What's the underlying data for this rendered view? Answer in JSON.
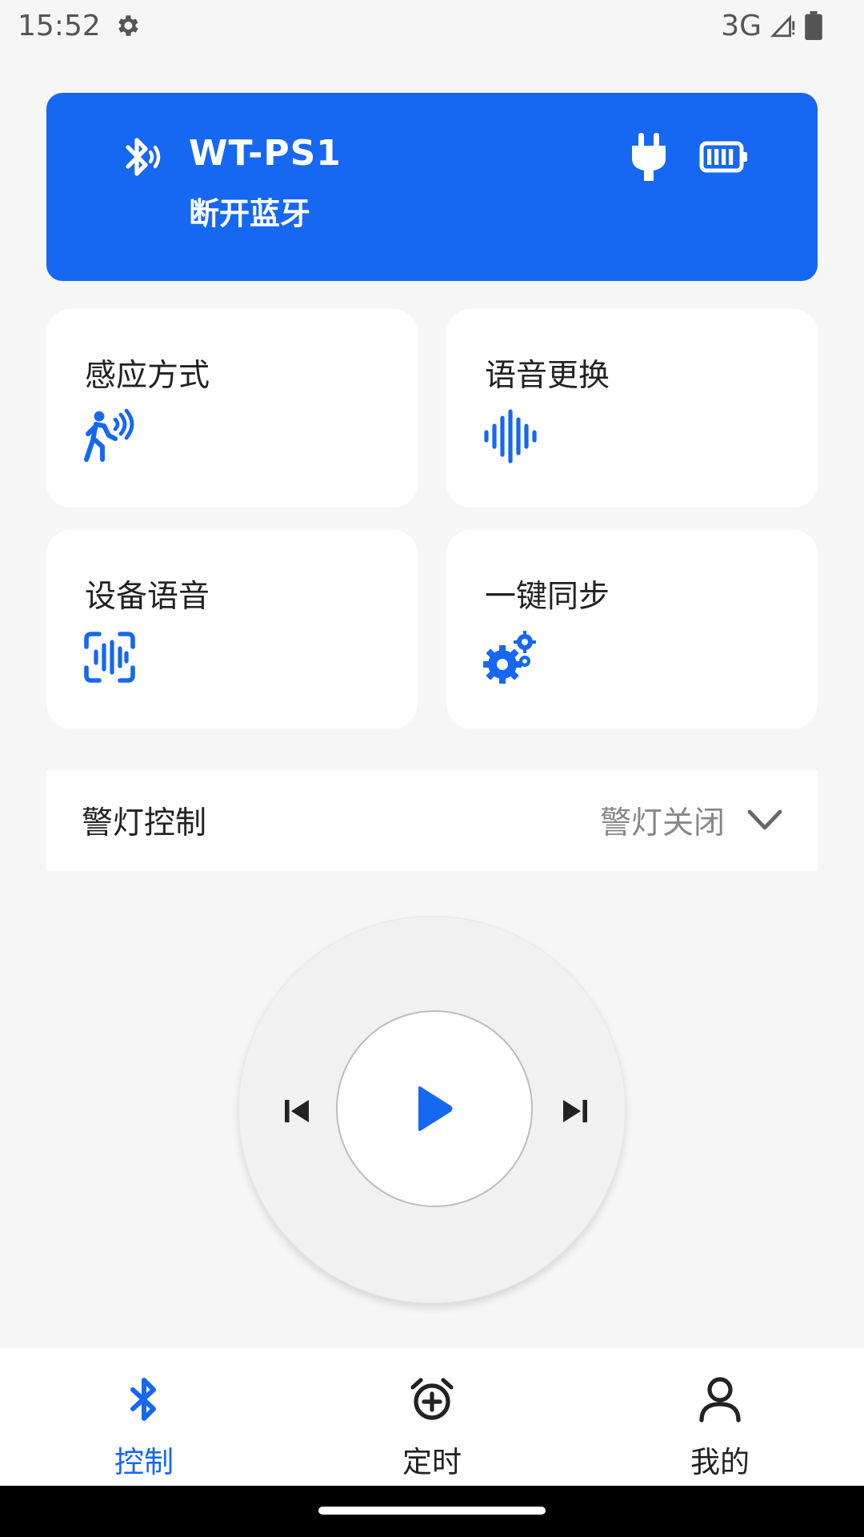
{
  "status_bar": {
    "time": "15:52",
    "network": "3G"
  },
  "device": {
    "name": "WT-PS1",
    "action": "断开蓝牙"
  },
  "features": [
    {
      "label": "感应方式",
      "icon": "motion-sensor-icon"
    },
    {
      "label": "语音更换",
      "icon": "sound-wave-icon"
    },
    {
      "label": "设备语音",
      "icon": "voice-recognition-icon"
    },
    {
      "label": "一键同步",
      "icon": "gears-icon"
    }
  ],
  "warning_light": {
    "label": "警灯控制",
    "value": "警灯关闭"
  },
  "nav": {
    "items": [
      {
        "label": "控制",
        "icon": "bluetooth-icon",
        "active": true
      },
      {
        "label": "定时",
        "icon": "alarm-add-icon",
        "active": false
      },
      {
        "label": "我的",
        "icon": "person-icon",
        "active": false
      }
    ]
  },
  "colors": {
    "accent": "#1667f2",
    "background": "#f6f6f6"
  }
}
